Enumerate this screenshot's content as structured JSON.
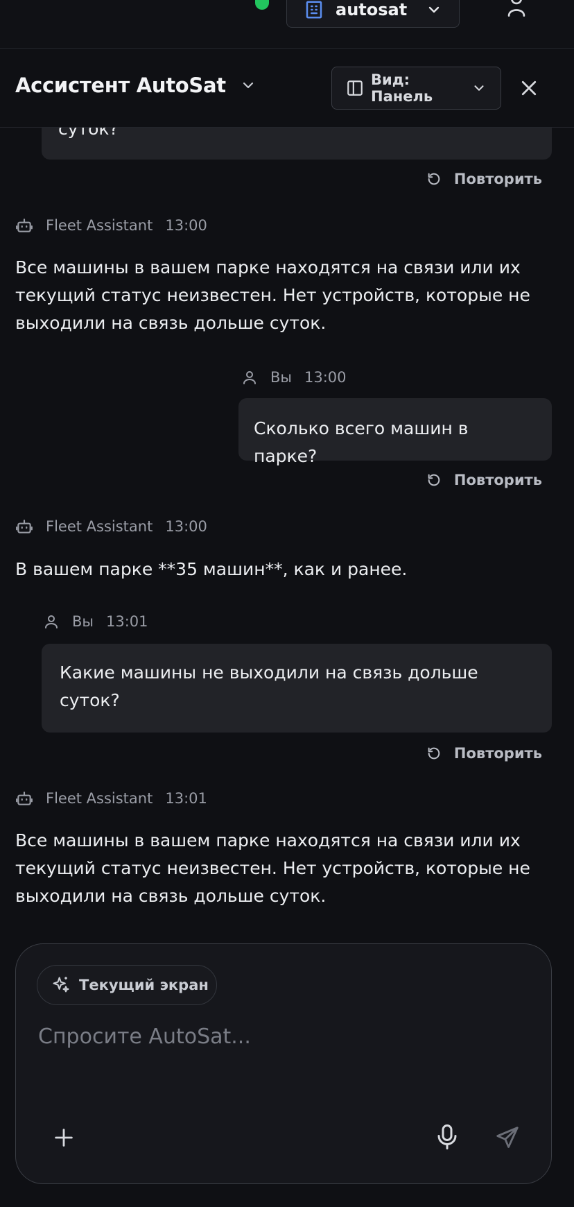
{
  "topbar": {
    "workspace_label": "autosat",
    "status_color": "#22c55e"
  },
  "header": {
    "title": "Ассистент AutoSat",
    "view_label": "Вид: Панель"
  },
  "messages": {
    "partial_user": {
      "text": "суток?"
    },
    "retry_label": "Повторить",
    "assistant_name": "Fleet Assistant",
    "user_name": "Вы",
    "items": [
      {
        "role": "assistant",
        "time": "13:00",
        "text": "Все машины в вашем парке находятся на связи или их текущий статус неизвестен. Нет устройств, которые не выходили на связь дольше суток."
      },
      {
        "role": "user",
        "time": "13:00",
        "text": "Сколько всего машин в парке?"
      },
      {
        "role": "assistant",
        "time": "13:00",
        "text": "В вашем парке **35 машин**, как и ранее."
      },
      {
        "role": "user",
        "time": "13:01",
        "text": "Какие машины не выходили на связь дольше суток?"
      },
      {
        "role": "assistant",
        "time": "13:01",
        "text": "Все машины в вашем парке находятся на связи или их текущий статус неизвестен. Нет устройств, которые не выходили на связь дольше суток."
      }
    ]
  },
  "composer": {
    "context_chip": "Текущий экран",
    "placeholder": "Спросите AutoSat...",
    "value": ""
  }
}
